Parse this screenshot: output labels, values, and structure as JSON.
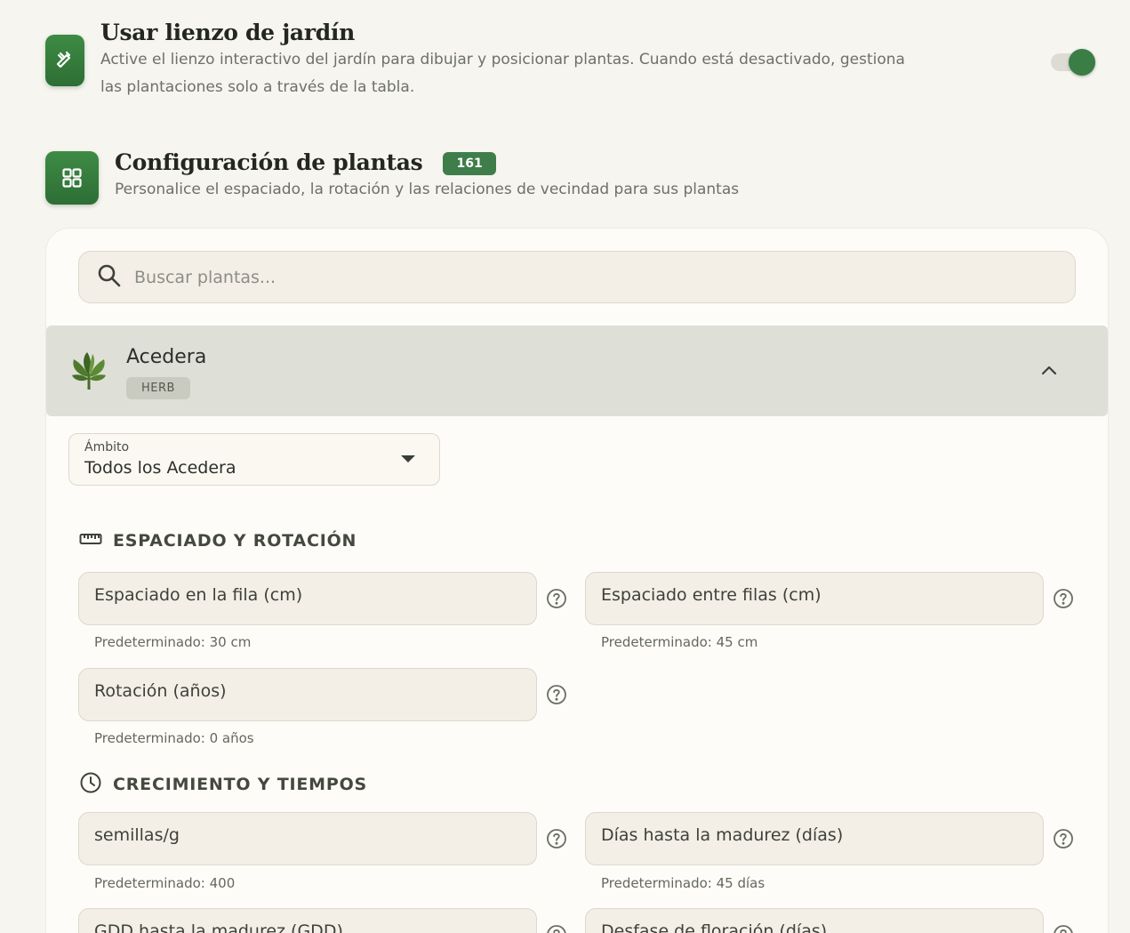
{
  "canvas_setting": {
    "title": "Usar lienzo de jardín",
    "description_line1": "Active el lienzo interactivo del jardín para dibujar y posicionar plantas. Cuando está desactivado, gestiona",
    "description_line2": "las plantaciones solo a través de la tabla.",
    "enabled": true,
    "icon": "pencil-ruler-icon"
  },
  "plant_config": {
    "title": "Configuración de plantas",
    "count": "161",
    "subtitle": "Personalice el espaciado, la rotación y las relaciones de vecindad para sus plantas",
    "icon": "grid-icon"
  },
  "search": {
    "placeholder": "Buscar plantas..."
  },
  "plant": {
    "name": "Acedera",
    "category": "HERB",
    "expanded": true
  },
  "scope": {
    "label": "Ámbito",
    "value": "Todos los Acedera"
  },
  "sections": {
    "spacing": {
      "title": "ESPACIADO Y ROTACIÓN",
      "fields": [
        {
          "label": "Espaciado en la fila (cm)",
          "hint": "Predeterminado: 30 cm"
        },
        {
          "label": "Espaciado entre filas (cm)",
          "hint": "Predeterminado: 45 cm"
        },
        {
          "label": "Rotación (años)",
          "hint": "Predeterminado: 0 años"
        }
      ]
    },
    "growth": {
      "title": "CRECIMIENTO Y TIEMPOS",
      "fields": [
        {
          "label": "semillas/g",
          "hint": "Predeterminado: 400"
        },
        {
          "label": "Días hasta la madurez (días)",
          "hint": "Predeterminado: 45 días"
        },
        {
          "label": "GDD hasta la madurez (GDD)",
          "hint": ""
        },
        {
          "label": "Desfase de floración (días)",
          "hint": ""
        }
      ]
    }
  },
  "colors": {
    "accent": "#3a7d45",
    "background": "#f6f5f0",
    "card": "#fdfcf8"
  }
}
